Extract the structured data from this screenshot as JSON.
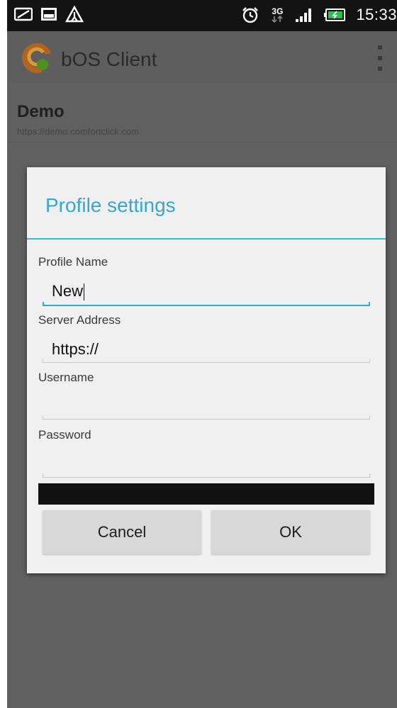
{
  "status_bar": {
    "time": "15:33",
    "network_label": "3G",
    "left_icons": [
      "notification-icon",
      "image-icon",
      "warning-icon"
    ],
    "right_icons": [
      "alarm-icon",
      "network-3g-icon",
      "signal-icon",
      "battery-charging-icon"
    ]
  },
  "app_bar": {
    "title": "bOS Client",
    "logo_icon": "bos-logo-icon",
    "menu_icon": "overflow-menu-icon"
  },
  "profile_list": [
    {
      "name": "Demo",
      "url": "https://demo.comfortclick.com"
    }
  ],
  "dialog": {
    "title": "Profile settings",
    "fields": [
      {
        "label": "Profile Name",
        "value": "New",
        "focused": true
      },
      {
        "label": "Server Address",
        "value": "https://",
        "focused": false
      },
      {
        "label": "Username",
        "value": "",
        "focused": false
      },
      {
        "label": "Password",
        "value": "",
        "focused": false
      }
    ],
    "cancel_label": "Cancel",
    "ok_label": "OK"
  },
  "colors": {
    "accent": "#33b5e5",
    "title_text": "#35a7d3",
    "dim_background": "#606060"
  }
}
